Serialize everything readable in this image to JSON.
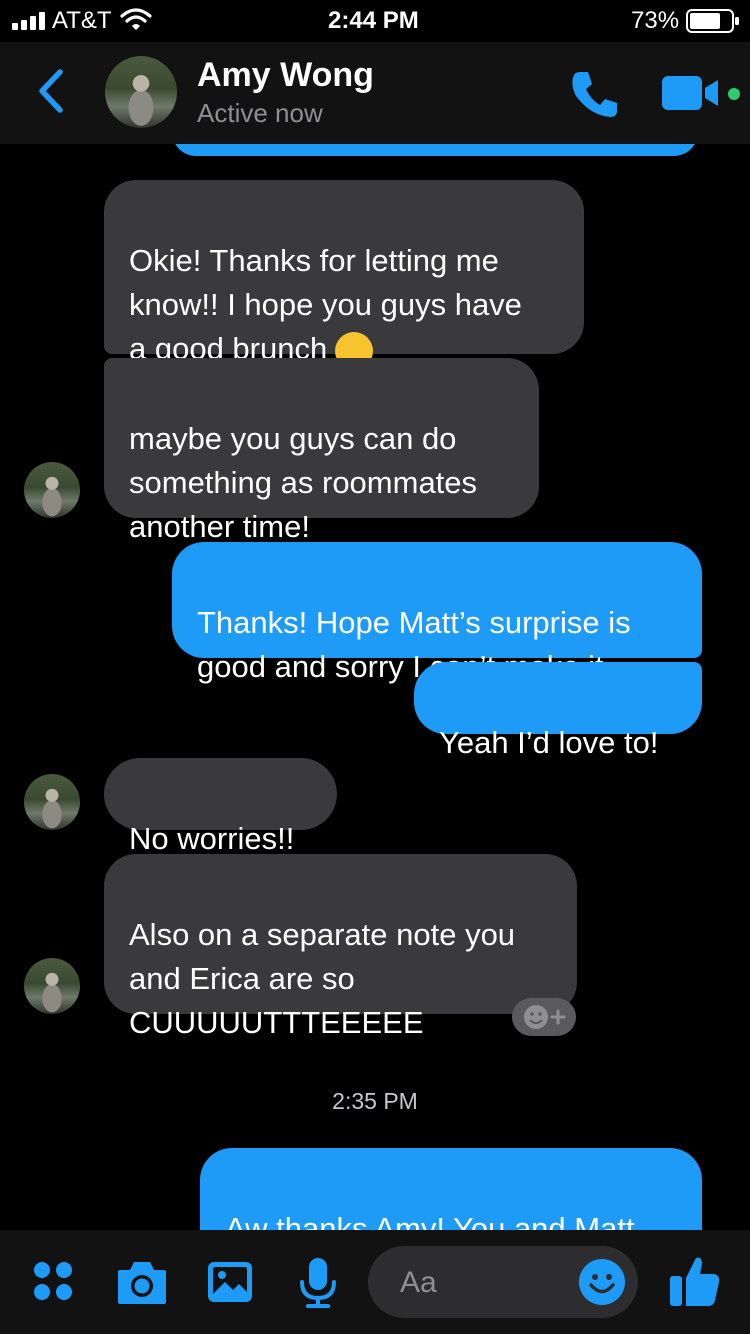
{
  "status_bar": {
    "carrier": "AT&T",
    "time": "2:44 PM",
    "battery": "73%"
  },
  "header": {
    "contact_name": "Amy Wong",
    "status": "Active now"
  },
  "messages": [
    {
      "from": "them",
      "text": "Okie! Thanks for letting me\nknow!! I hope you guys have\na good brunch"
    },
    {
      "from": "them",
      "text": "maybe you guys can do\nsomething as roommates\nanother time!"
    },
    {
      "from": "me",
      "text": "Thanks! Hope Matt’s surprise is\ngood and sorry I can’t make it"
    },
    {
      "from": "me",
      "text": "Yeah I’d love to!"
    },
    {
      "from": "them",
      "text": "No worries!!"
    },
    {
      "from": "them",
      "text": "Also on a separate note you\nand Erica are so\nCUUUUUTTTEEEEE"
    },
    {
      "from": "me",
      "text": "Aw thanks Amy! You and Matt"
    }
  ],
  "timestamp": "2:35 PM",
  "composer": {
    "placeholder": "Aa"
  },
  "icons": {
    "back": "chevron-left-icon",
    "call": "phone-icon",
    "video": "video-camera-icon",
    "menu": "four-dots-icon",
    "camera": "camera-icon",
    "gallery": "image-icon",
    "mic": "microphone-icon",
    "emoji": "smiley-icon",
    "like": "thumbs-up-icon"
  },
  "colors": {
    "accent": "#1e9af7",
    "incoming_bubble": "#3a3a3c",
    "background": "#000000",
    "online": "#2ecc71"
  }
}
